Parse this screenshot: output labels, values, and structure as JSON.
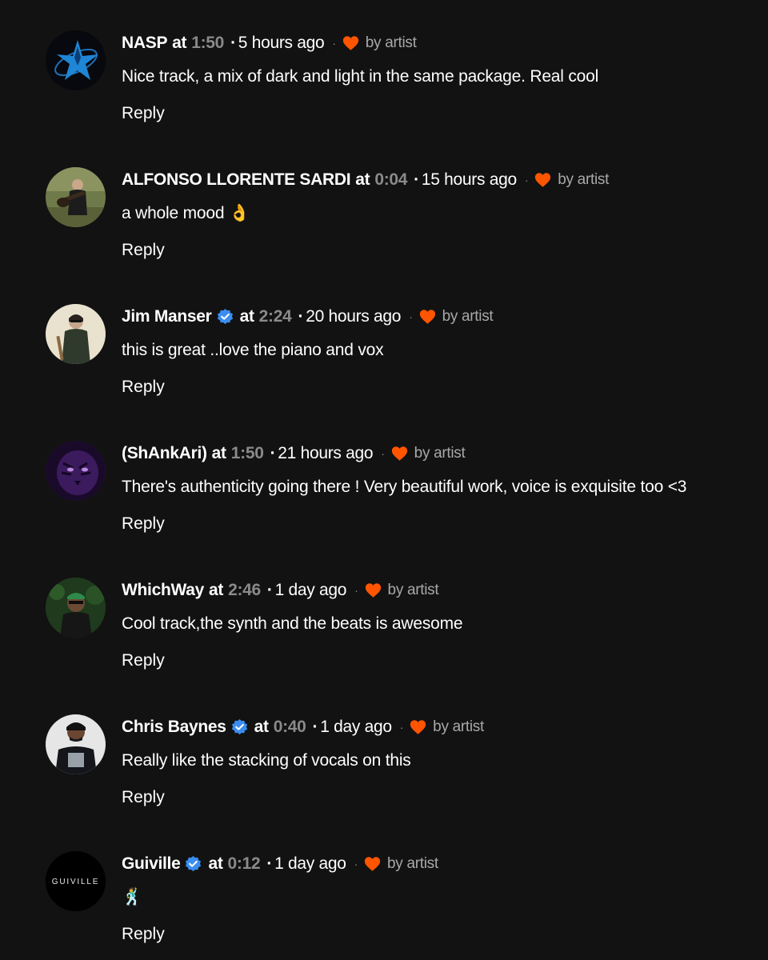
{
  "colors": {
    "background": "#121212",
    "text": "#ffffff",
    "timestamp": "#8a8a8a",
    "muted": "#a8a8a8",
    "heart": "#ff5500",
    "verified": "#3a8ef0"
  },
  "icons": {
    "heart": "heart-icon",
    "verified": "verified-badge-icon"
  },
  "comments": [
    {
      "username": "NASP",
      "verified": false,
      "at_label": "at",
      "timestamp": "1:50",
      "time_ago": "5 hours ago",
      "liked_label": "by artist",
      "body": "Nice track, a mix of dark and light in the same package. Real cool",
      "reply_label": "Reply"
    },
    {
      "username": "ALFONSO LLORENTE SARDI",
      "verified": false,
      "at_label": "at",
      "timestamp": "0:04",
      "time_ago": "15 hours ago",
      "liked_label": "by artist",
      "body": "a whole mood 👌",
      "reply_label": "Reply"
    },
    {
      "username": "Jim Manser",
      "verified": true,
      "at_label": "at",
      "timestamp": "2:24",
      "time_ago": "20 hours ago",
      "liked_label": "by artist",
      "body": "this is great ..love the piano and vox",
      "reply_label": "Reply"
    },
    {
      "username": "(ShAnkAri)",
      "verified": false,
      "at_label": "at",
      "timestamp": "1:50",
      "time_ago": "21 hours ago",
      "liked_label": "by artist",
      "body": "There's authenticity going there ! Very beautiful work, voice is exquisite too <3",
      "reply_label": "Reply"
    },
    {
      "username": "WhichWay",
      "verified": false,
      "at_label": "at",
      "timestamp": "2:46",
      "time_ago": "1 day ago",
      "liked_label": "by artist",
      "body": "Cool track,the synth and the beats is awesome",
      "reply_label": "Reply"
    },
    {
      "username": "Chris Baynes",
      "verified": true,
      "at_label": "at",
      "timestamp": "0:40",
      "time_ago": "1 day ago",
      "liked_label": "by artist",
      "body": "Really like the stacking of vocals on this",
      "reply_label": "Reply"
    },
    {
      "username": "Guiville",
      "verified": true,
      "at_label": "at",
      "timestamp": "0:12",
      "time_ago": "1 day ago",
      "liked_label": "by artist",
      "body": "🕺",
      "reply_label": "Reply",
      "avatar_text": "GUIVILLE"
    }
  ]
}
